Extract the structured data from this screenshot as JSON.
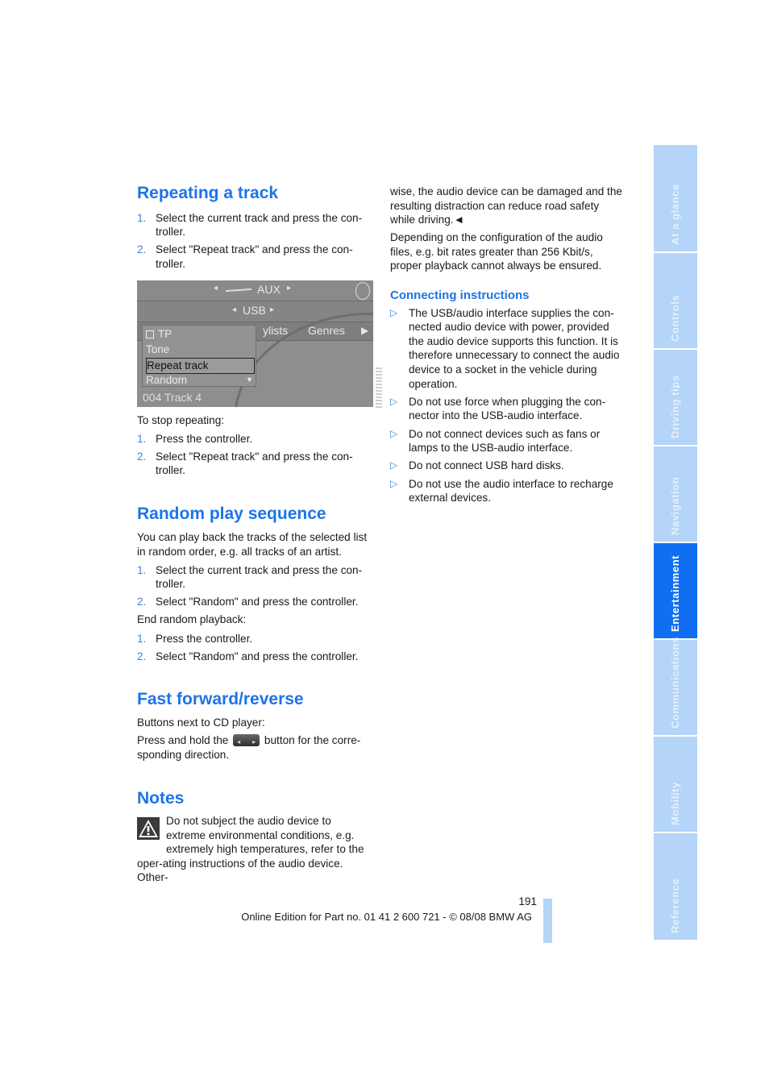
{
  "col1": {
    "repeat": {
      "title": "Repeating a track",
      "steps": [
        {
          "num": "1.",
          "text": "Select the current track and press the con-troller."
        },
        {
          "num": "2.",
          "text": "Select \"Repeat track\" and press the con-troller."
        }
      ],
      "stop_label": "To stop repeating:",
      "stop_steps": [
        {
          "num": "1.",
          "text": "Press the controller."
        },
        {
          "num": "2.",
          "text": "Select \"Repeat track\" and press the con-troller."
        }
      ]
    },
    "screen": {
      "row1_label": "AUX",
      "row2_label": "USB",
      "tabs": [
        "ylists",
        "Genres"
      ],
      "menu": [
        "TP",
        "Tone",
        "Repeat track",
        "Random"
      ],
      "selected_menu": "Repeat track",
      "track": "004 Track 4"
    },
    "random": {
      "title": "Random play sequence",
      "intro": "You can play back the tracks of the selected list in random order, e.g. all tracks of an artist.",
      "steps": [
        {
          "num": "1.",
          "text": "Select the current track and press the con-troller."
        },
        {
          "num": "2.",
          "text": "Select \"Random\" and press the controller."
        }
      ],
      "end_label": "End random playback:",
      "end_steps": [
        {
          "num": "1.",
          "text": "Press the controller."
        },
        {
          "num": "2.",
          "text": "Select \"Random\" and press the controller."
        }
      ]
    },
    "ff": {
      "title": "Fast forward/reverse",
      "line1": "Buttons next to CD player:",
      "line2_before": "Press and hold the",
      "line2_after": "button for the corre-sponding direction."
    },
    "notes": {
      "title": "Notes",
      "warning_text": "Do not subject the audio device to extreme environmental conditions, e.g. extremely high temperatures, refer to the oper-ating instructions of the audio device. Other-"
    }
  },
  "col2": {
    "cont1": "wise, the audio device can be damaged and the resulting distraction can reduce road safety while driving.",
    "end_mark": "◄",
    "cont2": "Depending on the configuration of the audio files, e.g. bit rates greater than 256 Kbit/s, proper playback cannot always be ensured.",
    "connecting": {
      "title": "Connecting instructions",
      "items": [
        "The USB/audio interface supplies the con-nected audio device with power, provided the audio device supports this function. It is therefore unnecessary to connect the audio device to a socket in the vehicle during operation.",
        "Do not use force when plugging the con-nector into the USB-audio interface.",
        "Do not connect devices such as fans or lamps to the USB-audio interface.",
        "Do not connect USB hard disks.",
        "Do not use the audio interface to recharge external devices."
      ]
    }
  },
  "footer": {
    "page_number": "191",
    "edition": "Online Edition for Part no. 01 41 2 600 721 - © 08/08 BMW AG"
  },
  "side_tabs": [
    {
      "label": "At a glance",
      "active": false
    },
    {
      "label": "Controls",
      "active": false
    },
    {
      "label": "Driving tips",
      "active": false
    },
    {
      "label": "Navigation",
      "active": false
    },
    {
      "label": "Entertainment",
      "active": true
    },
    {
      "label": "Communications",
      "active": false
    },
    {
      "label": "Mobility",
      "active": false
    },
    {
      "label": "Reference",
      "active": false
    }
  ],
  "colors": {
    "heading_blue": "#1c74e8",
    "tab_inactive": "#b4d4f8",
    "tab_active": "#0f6ff0"
  }
}
